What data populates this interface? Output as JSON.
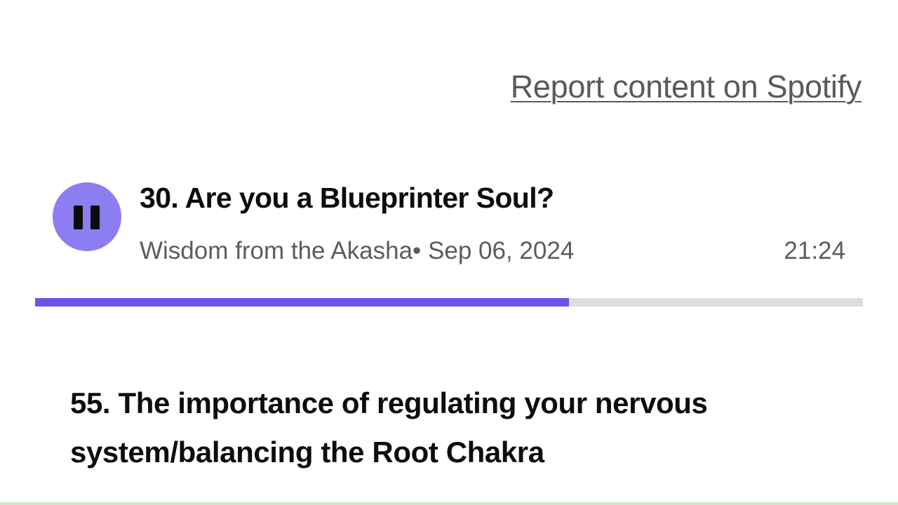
{
  "header": {
    "report_link": "Report content on Spotify"
  },
  "now_playing": {
    "title": "30. Are you a Blueprinter Soul?",
    "show": "Wisdom from the Akasha",
    "separator": "•",
    "date": "Sep 06, 2024",
    "duration": "21:24",
    "progress": 0.645,
    "state": "playing"
  },
  "next_episode": {
    "title": "55. The importance of regulating your nervous system/balancing the Root Chakra"
  },
  "colors": {
    "play_button": "#8c7df0",
    "progress_fill": "#6b55e8",
    "progress_track": "#dedede"
  },
  "icons": {
    "play_state_icon": "pause-icon"
  }
}
